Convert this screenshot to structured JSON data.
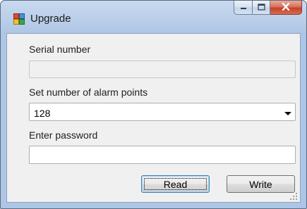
{
  "window": {
    "title": "Upgrade",
    "icon": "app-window-icon"
  },
  "caption": {
    "minimize_icon": "minimize-icon",
    "maximize_icon": "maximize-icon",
    "close_icon": "close-icon"
  },
  "form": {
    "serial_label": "Serial number",
    "serial_value": "",
    "alarm_label": "Set number of alarm points",
    "alarm_value": "128",
    "password_label": "Enter password",
    "password_value": ""
  },
  "buttons": {
    "read_label": "Read",
    "write_label": "Write"
  },
  "colors": {
    "title_accent": "#aec6e5",
    "close_button": "#c4402a"
  }
}
